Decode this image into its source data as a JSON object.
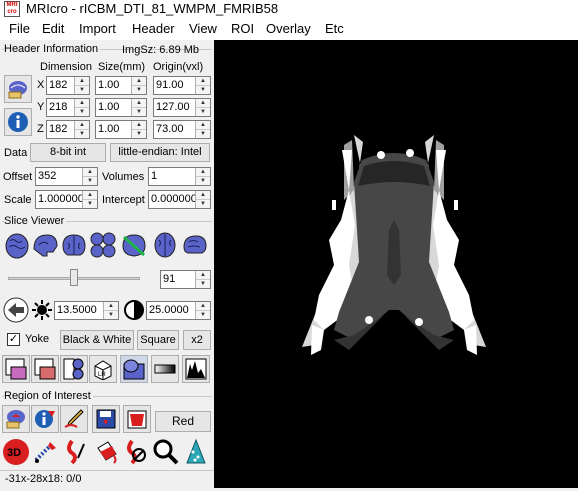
{
  "window": {
    "title": "MRIcro - rICBM_DTI_81_WMPM_FMRIB58",
    "app_icon_text": "MRI\ncro"
  },
  "menu": [
    "File",
    "Edit",
    "Import",
    "Header",
    "View",
    "ROI",
    "Overlay",
    "Etc"
  ],
  "header_info": {
    "section_label": "Header Information",
    "imgsz": "ImgSz: 6.89 Mb",
    "col_dimension": "Dimension",
    "col_size": "Size(mm)",
    "col_origin": "Origin(vxl)",
    "rows": [
      {
        "axis": "X",
        "dimension": "182",
        "size": "1.00",
        "origin": "91.00"
      },
      {
        "axis": "Y",
        "dimension": "218",
        "size": "1.00",
        "origin": "127.00"
      },
      {
        "axis": "Z",
        "dimension": "182",
        "size": "1.00",
        "origin": "73.00"
      }
    ],
    "data_label": "Data",
    "data_type": "8-bit int",
    "endian": "little-endian: Intel",
    "offset_label": "Offset",
    "offset": "352",
    "volumes_label": "Volumes",
    "volumes": "1",
    "scale_label": "Scale",
    "scale": "1.000000",
    "intercept_label": "Intercept",
    "intercept": "0.000000"
  },
  "slice_viewer": {
    "section_label": "Slice Viewer",
    "slice": "91",
    "slider_fraction": 0.5,
    "brightness": "13.5000",
    "contrast": "25.0000",
    "yoke_label": "Yoke",
    "yoke_checked": true,
    "bw_label": "Black & White",
    "square_label": "Square",
    "zoom_label": "x2"
  },
  "roi": {
    "section_label": "Region of Interest",
    "color_label": "Red"
  },
  "status": "-31x-28x18: 0/0",
  "colors": {
    "roi_accent": "#d81e1e",
    "brain_icon": "#5a63c8",
    "viewer_bg": "#000000"
  }
}
